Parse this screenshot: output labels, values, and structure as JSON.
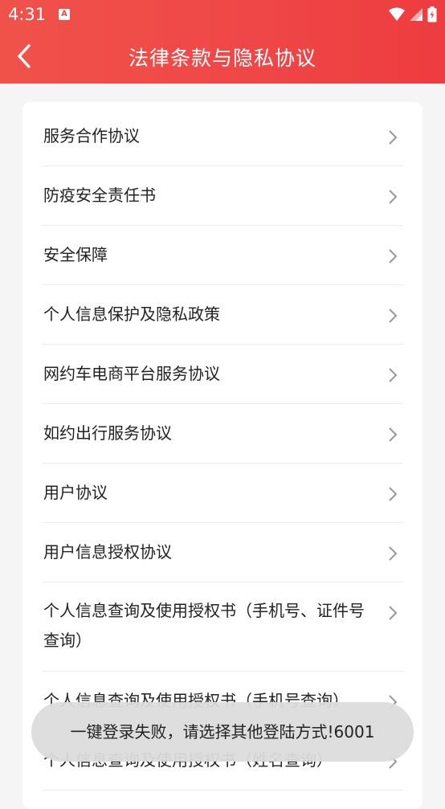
{
  "status_bar": {
    "time": "4:31",
    "notification_icon_letter": "A"
  },
  "header": {
    "title": "法律条款与隐私协议"
  },
  "colors": {
    "header_accent": "#ef4747",
    "toast_bg": "#dcdcdc"
  },
  "menu": {
    "items": [
      {
        "label": "服务合作协议"
      },
      {
        "label": "防疫安全责任书"
      },
      {
        "label": "安全保障"
      },
      {
        "label": "个人信息保护及隐私政策"
      },
      {
        "label": "网约车电商平台服务协议"
      },
      {
        "label": "如约出行服务协议"
      },
      {
        "label": "用户协议"
      },
      {
        "label": "用户信息授权协议"
      },
      {
        "label": "个人信息查询及使用授权书（手机号、证件号查询）"
      },
      {
        "label": "个人信息查询及使用授权书（手机号查询）"
      },
      {
        "label": "个人信息查询及使用授权书（姓名查询）"
      }
    ]
  },
  "toast": {
    "message": "一键登录失败，请选择其他登陆方式!6001"
  }
}
